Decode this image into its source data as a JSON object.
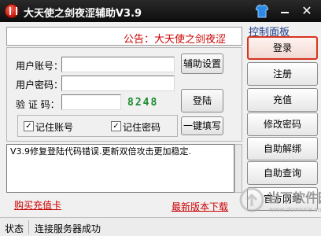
{
  "window": {
    "title": "大天使之剑夜涩辅助V3.9"
  },
  "notice": {
    "text": "公告：大天使之剑夜涩"
  },
  "form": {
    "account_label": "用户账号：",
    "password_label": "用户密码：",
    "captcha_label": "验 证 码：",
    "account_value": "",
    "password_value": "",
    "captcha_input_value": "",
    "captcha_code": "8248"
  },
  "buttons": {
    "settings": "辅助设置",
    "login": "登陆",
    "quick_fill": "一键填写"
  },
  "checkboxes": {
    "remember_account": "记住账号",
    "remember_password": "记住密码",
    "check_mark": "✓"
  },
  "log": {
    "text": "V3.9修复登陆代码错误.更新双倍攻击更加稳定."
  },
  "links": {
    "buy_card": "购买充值卡",
    "download": "最新版本下载"
  },
  "panel": {
    "title": "控制面板",
    "items": [
      {
        "label": "登录"
      },
      {
        "label": "注册"
      },
      {
        "label": "充值"
      },
      {
        "label": "修改密码"
      },
      {
        "label": "自助解绑"
      },
      {
        "label": "自助查询"
      },
      {
        "label": "官方网站"
      }
    ]
  },
  "status": {
    "label": "状态",
    "text": "连接服务器成功"
  },
  "watermark": {
    "text": "当下软件园",
    "sub": "www.downxia.com"
  },
  "colors": {
    "accent_red": "#cc0000",
    "captcha_green": "#1a8c2e",
    "panel_title_blue": "#1f3c8a",
    "active_border": "#d8341f"
  }
}
